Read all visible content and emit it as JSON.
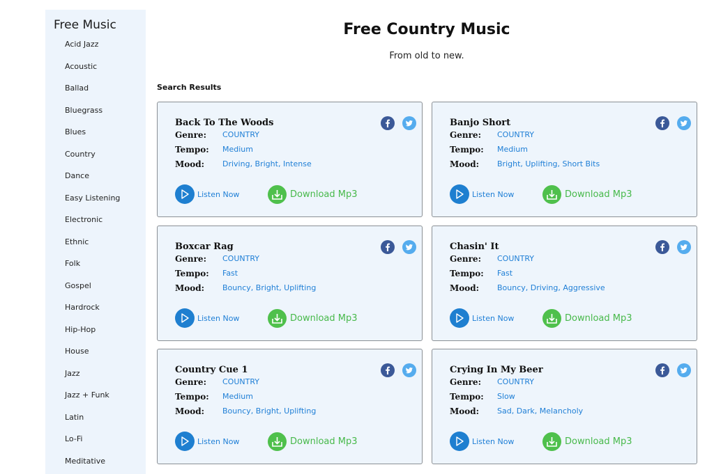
{
  "sidebar": {
    "title": "Free Music",
    "items": [
      {
        "label": "Acid Jazz"
      },
      {
        "label": "Acoustic"
      },
      {
        "label": "Ballad"
      },
      {
        "label": "Bluegrass"
      },
      {
        "label": "Blues"
      },
      {
        "label": "Country"
      },
      {
        "label": "Dance"
      },
      {
        "label": "Easy Listening"
      },
      {
        "label": "Electronic"
      },
      {
        "label": "Ethnic"
      },
      {
        "label": "Folk"
      },
      {
        "label": "Gospel"
      },
      {
        "label": "Hardrock"
      },
      {
        "label": "Hip-Hop"
      },
      {
        "label": "House"
      },
      {
        "label": "Jazz"
      },
      {
        "label": "Jazz + Funk"
      },
      {
        "label": "Latin"
      },
      {
        "label": "Lo-Fi"
      },
      {
        "label": "Meditative"
      }
    ]
  },
  "header": {
    "title": "Free Country Music",
    "subtitle": "From old to new."
  },
  "results": {
    "heading": "Search Results",
    "labels": {
      "genre": "Genre:",
      "tempo": "Tempo:",
      "mood": "Mood:",
      "listen": "Listen Now",
      "download": "Download Mp3"
    },
    "tracks": [
      {
        "title": "Back To The Woods",
        "genre": "COUNTRY",
        "tempo": "Medium",
        "mood": "Driving, Bright, Intense"
      },
      {
        "title": "Banjo Short",
        "genre": "COUNTRY",
        "tempo": "Medium",
        "mood": "Bright, Uplifting, Short Bits"
      },
      {
        "title": "Boxcar Rag",
        "genre": "COUNTRY",
        "tempo": "Fast",
        "mood": "Bouncy, Bright, Uplifting"
      },
      {
        "title": "Chasin' It",
        "genre": "COUNTRY",
        "tempo": "Fast",
        "mood": "Bouncy, Driving, Aggressive"
      },
      {
        "title": "Country Cue 1",
        "genre": "COUNTRY",
        "tempo": "Medium",
        "mood": "Bouncy, Bright, Uplifting"
      },
      {
        "title": "Crying In My Beer",
        "genre": "COUNTRY",
        "tempo": "Slow",
        "mood": "Sad, Dark, Melancholy"
      }
    ]
  },
  "icons": {
    "facebook": "facebook-icon",
    "twitter": "twitter-icon",
    "play": "play-icon",
    "download": "download-icon"
  },
  "colors": {
    "link_blue": "#1f7fd6",
    "download_green": "#47b94a",
    "facebook": "#3b5998",
    "twitter": "#55acee",
    "card_bg": "#eef5fc",
    "sidebar_bg": "#edf4fc"
  }
}
